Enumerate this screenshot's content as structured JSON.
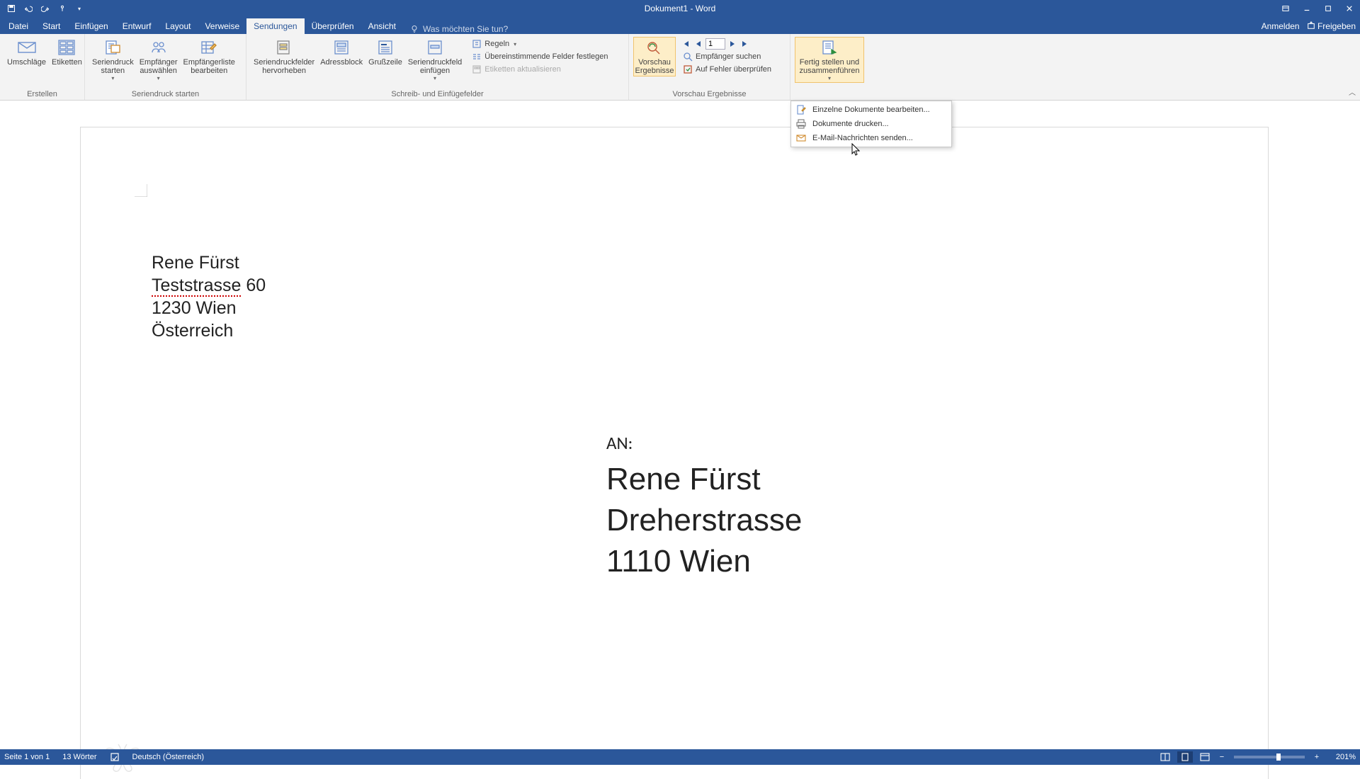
{
  "app": {
    "title": "Dokument1 - Word"
  },
  "qat": {
    "save": "save",
    "undo": "undo",
    "redo": "redo",
    "touch": "touch-mode",
    "more": "customize"
  },
  "tabs": {
    "file": "Datei",
    "home": "Start",
    "insert": "Einfügen",
    "design": "Entwurf",
    "layout": "Layout",
    "references": "Verweise",
    "mailings": "Sendungen",
    "review": "Überprüfen",
    "view": "Ansicht",
    "tellme_placeholder": "Was möchten Sie tun?",
    "signin": "Anmelden",
    "share": "Freigeben"
  },
  "ribbon": {
    "create": {
      "envelopes": "Umschläge",
      "labels": "Etiketten",
      "group": "Erstellen"
    },
    "start_merge": {
      "start": "Seriendruck\nstarten",
      "select": "Empfänger\nauswählen",
      "edit": "Empfängerliste\nbearbeiten",
      "group": "Seriendruck starten"
    },
    "fields": {
      "highlight": "Seriendruckfelder\nhervorheben",
      "address": "Adressblock",
      "greeting": "Grußzeile",
      "insert": "Seriendruckfeld\neinfügen",
      "rules": "Regeln",
      "match": "Übereinstimmende Felder festlegen",
      "update": "Etiketten aktualisieren",
      "group": "Schreib- und Einfügefelder"
    },
    "preview": {
      "preview": "Vorschau\nErgebnisse",
      "record": "1",
      "find": "Empfänger suchen",
      "errors": "Auf Fehler überprüfen",
      "group": "Vorschau Ergebnisse"
    },
    "finish": {
      "finish": "Fertig stellen und\nzusammenführen",
      "edit_docs": "Einzelne Dokumente bearbeiten...",
      "print_docs": "Dokumente drucken...",
      "send_mail": "E-Mail-Nachrichten senden..."
    }
  },
  "document": {
    "sender": {
      "name": "Rene Fürst",
      "street": "Teststrasse 60",
      "city": "1230 Wien",
      "country": "Österreich",
      "spelled_word": "Teststrasse"
    },
    "recipient": {
      "label": "AN:",
      "name": "Rene Fürst",
      "street": "Dreherstrasse",
      "city": "1110 Wien"
    }
  },
  "status": {
    "page": "Seite 1 von 1",
    "words": "13 Wörter",
    "lang": "Deutsch (Österreich)",
    "zoom": "201%"
  }
}
